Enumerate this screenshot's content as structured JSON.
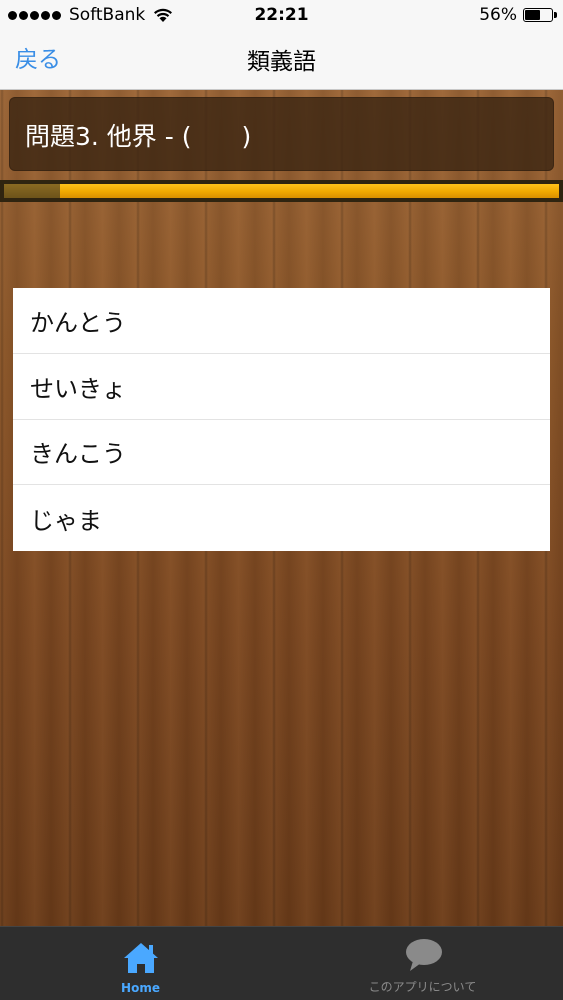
{
  "status_bar": {
    "carrier": "SoftBank",
    "time": "22:21",
    "battery_percent": "56%",
    "battery_level": 0.56
  },
  "nav": {
    "back_label": "戻る",
    "title": "類義語"
  },
  "question": {
    "text": "問題3. 他界 - (　　)"
  },
  "progress": {
    "value": 0.1
  },
  "answers": [
    {
      "label": "かんとう"
    },
    {
      "label": "せいきょ"
    },
    {
      "label": "きんこう"
    },
    {
      "label": "じゃま"
    }
  ],
  "tab_bar": {
    "tabs": [
      {
        "label": "Home",
        "icon": "home-icon",
        "selected": true
      },
      {
        "label": "このアプリについて",
        "icon": "speech-bubble-icon",
        "selected": false
      }
    ]
  },
  "colors": {
    "accent": "#3a8ee6",
    "tab_selected": "#4aa8ff",
    "progress": "#f0a800"
  }
}
